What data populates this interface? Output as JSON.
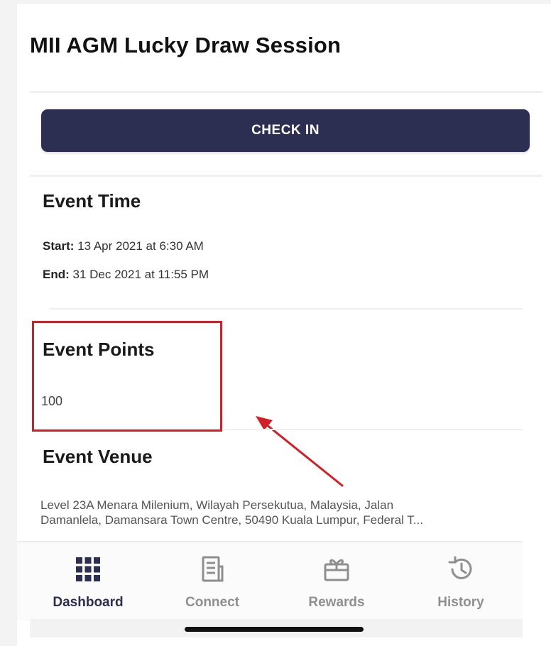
{
  "page": {
    "title": "MII AGM Lucky Draw Session"
  },
  "checkin": {
    "label": "CHECK IN"
  },
  "event_time": {
    "heading": "Event Time",
    "start_label": "Start:",
    "start_value": "13 Apr 2021 at 6:30 AM",
    "end_label": "End:",
    "end_value": "31 Dec 2021 at 11:55 PM"
  },
  "event_points": {
    "heading": "Event Points",
    "value": "100"
  },
  "event_venue": {
    "heading": "Event Venue",
    "line1": "Level 23A Menara Milenium, Wilayah Persekutua, Malaysia, Jalan",
    "line2": "Damanlela, Damansara Town Centre, 50490 Kuala Lumpur, Federal T..."
  },
  "bottom_nav": {
    "items": [
      {
        "label": "Dashboard",
        "icon": "grid-icon",
        "active": true
      },
      {
        "label": "Connect",
        "icon": "document-icon",
        "active": false
      },
      {
        "label": "Rewards",
        "icon": "gift-icon",
        "active": false
      },
      {
        "label": "History",
        "icon": "history-icon",
        "active": false
      }
    ]
  },
  "colors": {
    "accent": "#2c2f52",
    "annotation": "#d21f26",
    "inactive": "#8f8f8f"
  }
}
